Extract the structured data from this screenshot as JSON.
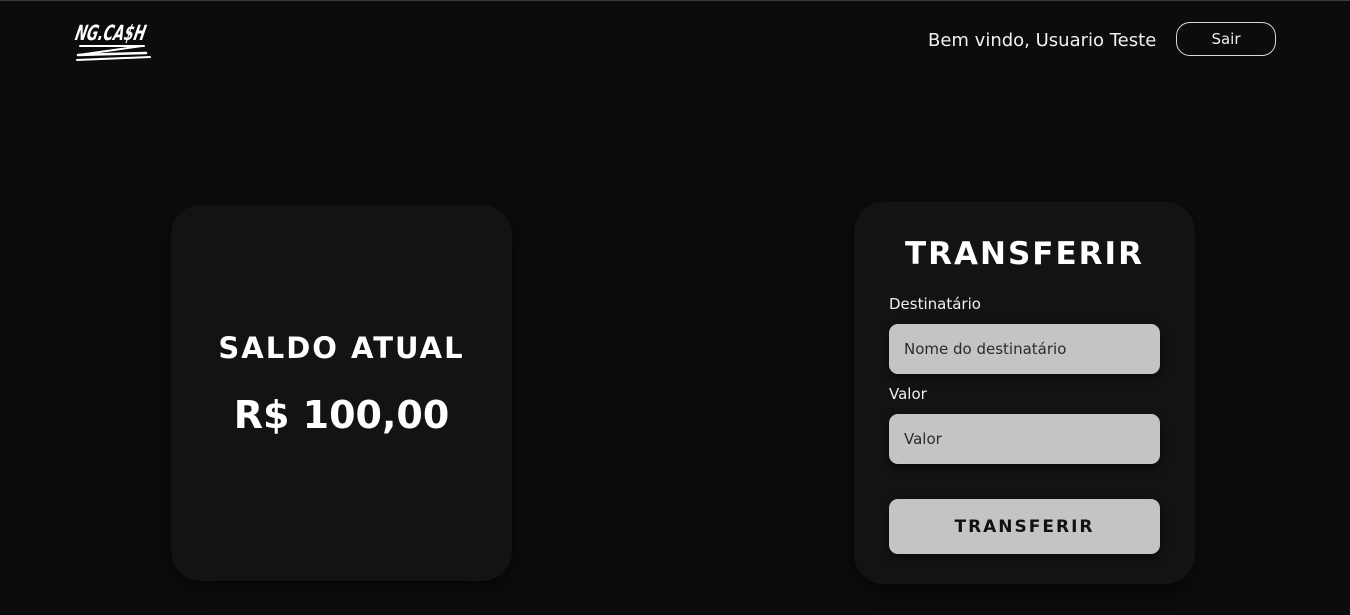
{
  "header": {
    "logo_text": "NG.CA$H",
    "welcome_text": "Bem vindo, Usuario Teste",
    "logout_label": "Sair"
  },
  "balance_card": {
    "title": "SALDO ATUAL",
    "value": "R$ 100,00"
  },
  "transfer_card": {
    "title": "TRANSFERIR",
    "recipient_label": "Destinatário",
    "recipient_placeholder": "Nome do destinatário",
    "amount_label": "Valor",
    "amount_placeholder": "Valor",
    "submit_label": "TRANSFERIR"
  },
  "colors": {
    "background": "#0c0c0c",
    "card": "#131313",
    "input": "#c4c4c4",
    "text": "#ffffff"
  }
}
